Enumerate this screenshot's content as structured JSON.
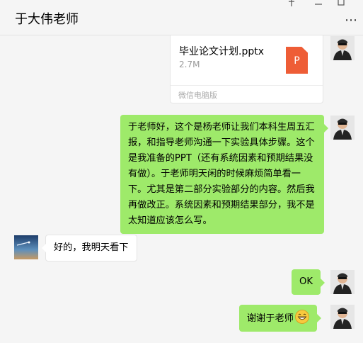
{
  "header": {
    "title": "于大伟老师",
    "more_icon": "⋯",
    "pin_icon": "✕",
    "min_icon": "—",
    "max_icon": "☐"
  },
  "file": {
    "name": "毕业论文计划.pptx",
    "size": "2.7M",
    "icon_letter": "P",
    "icon_color": "#ee5d36",
    "source": "微信电脑版"
  },
  "messages": [
    {
      "from": "me",
      "text": "于老师好，这个是杨老师让我们本科生周五汇报，和指导老师沟通一下实验具体步骤。这个是我准备的PPT（还有系统因素和预期结果没有做）。于老师明天闲的时候麻烦简单看一下。尤其是第二部分实验部分的内容。然后我再做改正。系统因素和预期结果部分，我不是太知道应该怎么写。"
    },
    {
      "from": "friend",
      "text": "好的，我明天看下"
    },
    {
      "from": "me",
      "text": "OK"
    },
    {
      "from": "me",
      "text": "谢谢于老师",
      "emoji": "grin-emoji"
    }
  ],
  "colors": {
    "my_bubble": "#9eea6a",
    "friend_bubble": "#ffffff",
    "background": "#f5f5f5"
  }
}
